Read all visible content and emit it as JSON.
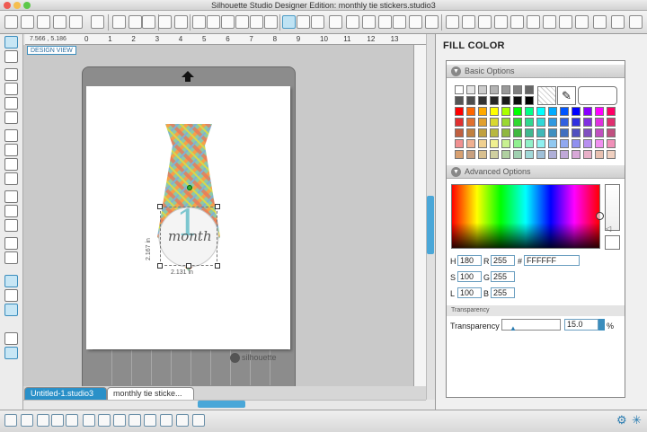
{
  "window": {
    "title": "Silhouette Studio Designer Edition: monthly tie stickers.studio3"
  },
  "canvas": {
    "view_label": "DESIGN VIEW",
    "coords": "7.566 , 5.186",
    "ruler_ticks": [
      "0",
      "1",
      "2",
      "3",
      "4",
      "5",
      "6",
      "7",
      "8",
      "9",
      "10",
      "11",
      "12",
      "13"
    ],
    "mat_brand": "silhouette",
    "sticker_number": "1",
    "sticker_word": "month",
    "dim_v": "2.167 in",
    "dim_h": "2.131 in"
  },
  "tabs": [
    {
      "label": "Untitled-1.studio3"
    },
    {
      "label": "monthly tie sticke..."
    }
  ],
  "panel": {
    "title": "FILL COLOR",
    "basic_label": "Basic Options",
    "advanced_label": "Advanced Options",
    "transparency_header": "Transparency",
    "transparency_label": "Transparency",
    "transparency_value": "15.0",
    "percent": "%",
    "hsl": {
      "h_label": "H",
      "h": "180",
      "s_label": "S",
      "s": "100",
      "l_label": "L",
      "l": "100"
    },
    "rgb": {
      "r_label": "R",
      "r": "255",
      "g_label": "G",
      "g": "255",
      "b_label": "B",
      "b": "255"
    },
    "hex_label": "#",
    "hex": "FFFFFF",
    "swatches": [
      [
        "#ffffff",
        "#e6e6e6",
        "#cccccc",
        "#b3b3b3",
        "#999999",
        "#808080",
        "#666666"
      ],
      [
        "#555555",
        "#4d4d4d",
        "#333333",
        "#262626",
        "#1a1a1a",
        "#0d0d0d",
        "#000000"
      ],
      [
        "#ff0000",
        "#ff6600",
        "#ffaa00",
        "#ffff00",
        "#aaff00",
        "#00ff00",
        "#00ff88",
        "#00ffff",
        "#00aaff",
        "#0055ff",
        "#0000ff",
        "#8800ff",
        "#ff00ff",
        "#ff0066"
      ],
      [
        "#e03030",
        "#e07030",
        "#e0a030",
        "#d8d830",
        "#9ad830",
        "#30d830",
        "#30d890",
        "#30d8d8",
        "#3098e0",
        "#3060e0",
        "#3030e0",
        "#8030e0",
        "#e030e0",
        "#e03070"
      ],
      [
        "#c06040",
        "#c08040",
        "#c0a040",
        "#b8b840",
        "#90b840",
        "#40b840",
        "#40b890",
        "#40b8b8",
        "#4090c0",
        "#4070c0",
        "#5050c0",
        "#8050c0",
        "#c050c0",
        "#c05080"
      ],
      [
        "#f09090",
        "#f0b090",
        "#f0d090",
        "#f0f090",
        "#c8f090",
        "#90f090",
        "#90f0c8",
        "#90f0f0",
        "#90c8f0",
        "#90a8f0",
        "#9090f0",
        "#b890f0",
        "#f090f0",
        "#f090b8"
      ],
      [
        "#d8a070",
        "#c8a080",
        "#d8c090",
        "#d0d0a0",
        "#b0d0a0",
        "#a0d0b0",
        "#a0d8d8",
        "#a0c0d8",
        "#b0b0d8",
        "#c0a8d8",
        "#d8a8d8",
        "#e8b0c8",
        "#e8c0b0",
        "#f0d0c0"
      ]
    ]
  }
}
